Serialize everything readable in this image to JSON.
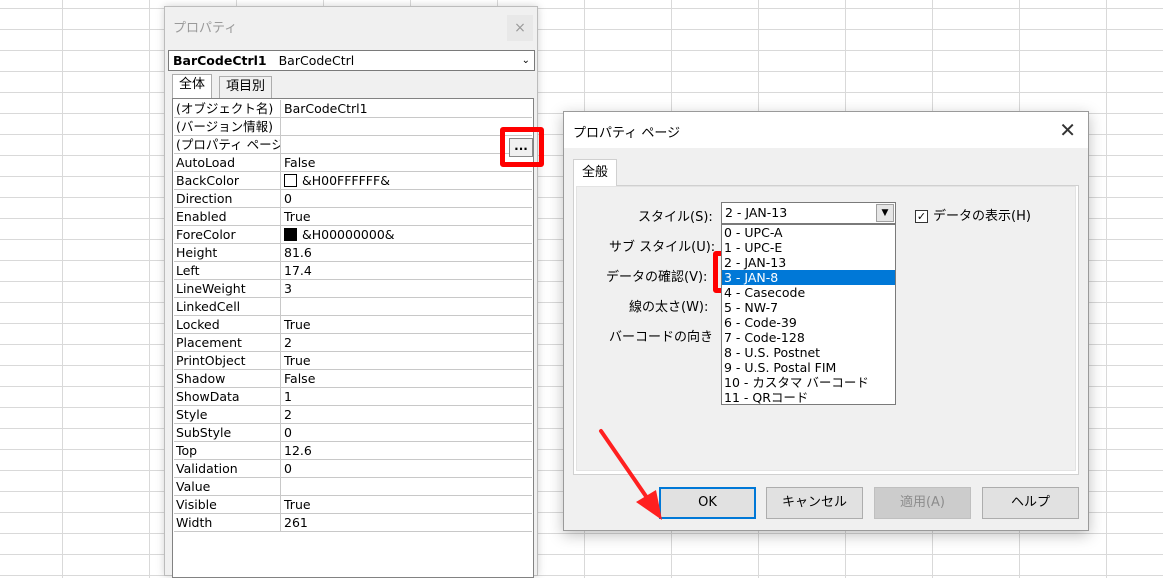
{
  "properties_window": {
    "title": "プロパティ",
    "close_glyph": "×",
    "object_name": "BarCodeCtrl1",
    "object_type": "BarCodeCtrl",
    "tabs": [
      "全体",
      "項目別"
    ],
    "ellipsis_label": "...",
    "rows": [
      {
        "name": "(オブジェクト名)",
        "value": ""
      },
      {
        "name": "(バージョン情報)",
        "value": ""
      },
      {
        "name": "(プロパティ ページ)",
        "value": ""
      },
      {
        "name": "AutoLoad",
        "value": "False"
      },
      {
        "name": "BackColor",
        "value": "&H00FFFFFF&"
      },
      {
        "name": "Direction",
        "value": "0"
      },
      {
        "name": "Enabled",
        "value": "True"
      },
      {
        "name": "ForeColor",
        "value": "&H00000000&"
      },
      {
        "name": "Height",
        "value": "81.6"
      },
      {
        "name": "Left",
        "value": "17.4"
      },
      {
        "name": "LineWeight",
        "value": "3"
      },
      {
        "name": "LinkedCell",
        "value": ""
      },
      {
        "name": "Locked",
        "value": "True"
      },
      {
        "name": "Placement",
        "value": "2"
      },
      {
        "name": "PrintObject",
        "value": "True"
      },
      {
        "name": "Shadow",
        "value": "False"
      },
      {
        "name": "ShowData",
        "value": "1"
      },
      {
        "name": "Style",
        "value": "2"
      },
      {
        "name": "SubStyle",
        "value": "0"
      },
      {
        "name": "Top",
        "value": "12.6"
      },
      {
        "name": "Validation",
        "value": "0"
      },
      {
        "name": "Value",
        "value": ""
      },
      {
        "name": "Visible",
        "value": "True"
      },
      {
        "name": "Width",
        "value": "261"
      }
    ],
    "object_name_value": "BarCodeCtrl1",
    "backcolor_swatch": "#ffffff",
    "forecolor_swatch": "#000000"
  },
  "dialog": {
    "title": "プロパティ ページ",
    "close_glyph": "✕",
    "tab": "全般",
    "labels": {
      "style": "スタイル(S):",
      "substyle": "サブ スタイル(U):",
      "validation": "データの確認(V):",
      "lineweight": "線の太さ(W):",
      "direction": "バーコードの向き"
    },
    "style_value": "2 - JAN-13",
    "style_options": [
      "0 - UPC-A",
      "1 - UPC-E",
      "2 - JAN-13",
      "3 - JAN-8",
      "4 - Casecode",
      "5 - NW-7",
      "6 - Code-39",
      "7 - Code-128",
      "8 - U.S. Postnet",
      "9 - U.S. Postal FIM",
      "10 - カスタマ バーコード",
      "11 - QRコード"
    ],
    "selected_option": "3 - JAN-8",
    "show_data_label": "データの表示(H)",
    "show_data_checked": true,
    "buttons": {
      "ok": "OK",
      "cancel": "キャンセル",
      "apply": "適用(A)",
      "help": "ヘルプ"
    }
  },
  "colors": {
    "highlight": "#ff0000",
    "selection": "#0078d7"
  }
}
